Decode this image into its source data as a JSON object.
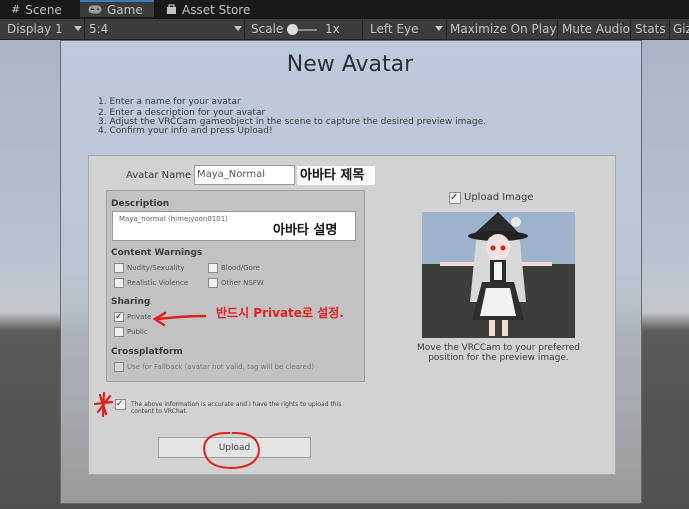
{
  "tabs": [
    {
      "label": "Scene",
      "icon": "hash-icon"
    },
    {
      "label": "Game",
      "icon": "gamepad-icon"
    },
    {
      "label": "Asset Store",
      "icon": "store-icon"
    }
  ],
  "toolbar": {
    "display": "Display 1",
    "aspect": "5:4",
    "scale_label": "Scale",
    "scale_value": "1x",
    "eye": "Left Eye",
    "maximize": "Maximize On Play",
    "mute": "Mute Audio",
    "stats": "Stats",
    "gizmos": "Giz"
  },
  "panel": {
    "title": "New Avatar",
    "instructions": [
      "1. Enter a name for your avatar",
      "2. Enter a description for your avatar",
      "3. Adjust the VRCCam gameobject in the scene to capture the desired preview image.",
      "4. Confirm your info and press Upload!"
    ],
    "avatar_name_label": "Avatar Name",
    "avatar_name_value": "Maya_Normal",
    "description_label": "Description",
    "description_value": "Maya_normal (himejyoon0101)",
    "content_warnings_label": "Content Warnings",
    "warnings": [
      "Nudity/Sexuality",
      "Blood/Gore",
      "Realistic Violence",
      "Other NSFW"
    ],
    "sharing_label": "Sharing",
    "sharing_options": [
      "Private",
      "Public"
    ],
    "sharing_selected": "Private",
    "crossplatform_label": "Crossplatform",
    "fallback_label": "Use for Fallback (avatar not valid, tag will be cleared)",
    "upload_image_label": "Upload Image",
    "upload_image_checked": true,
    "move_caption": [
      "Move the VRCCam to your preferred",
      "position for the preview image."
    ],
    "agree_text": [
      "The above information is accurate and I have the rights to upload this",
      "content to VRChat."
    ],
    "agree_checked": true,
    "upload_button": "Upload"
  },
  "annotations": {
    "name_note": "아바타 제목",
    "desc_note": "아바타 설명",
    "private_note": "반드시 Private로 설정.",
    "color": "#e02020"
  }
}
